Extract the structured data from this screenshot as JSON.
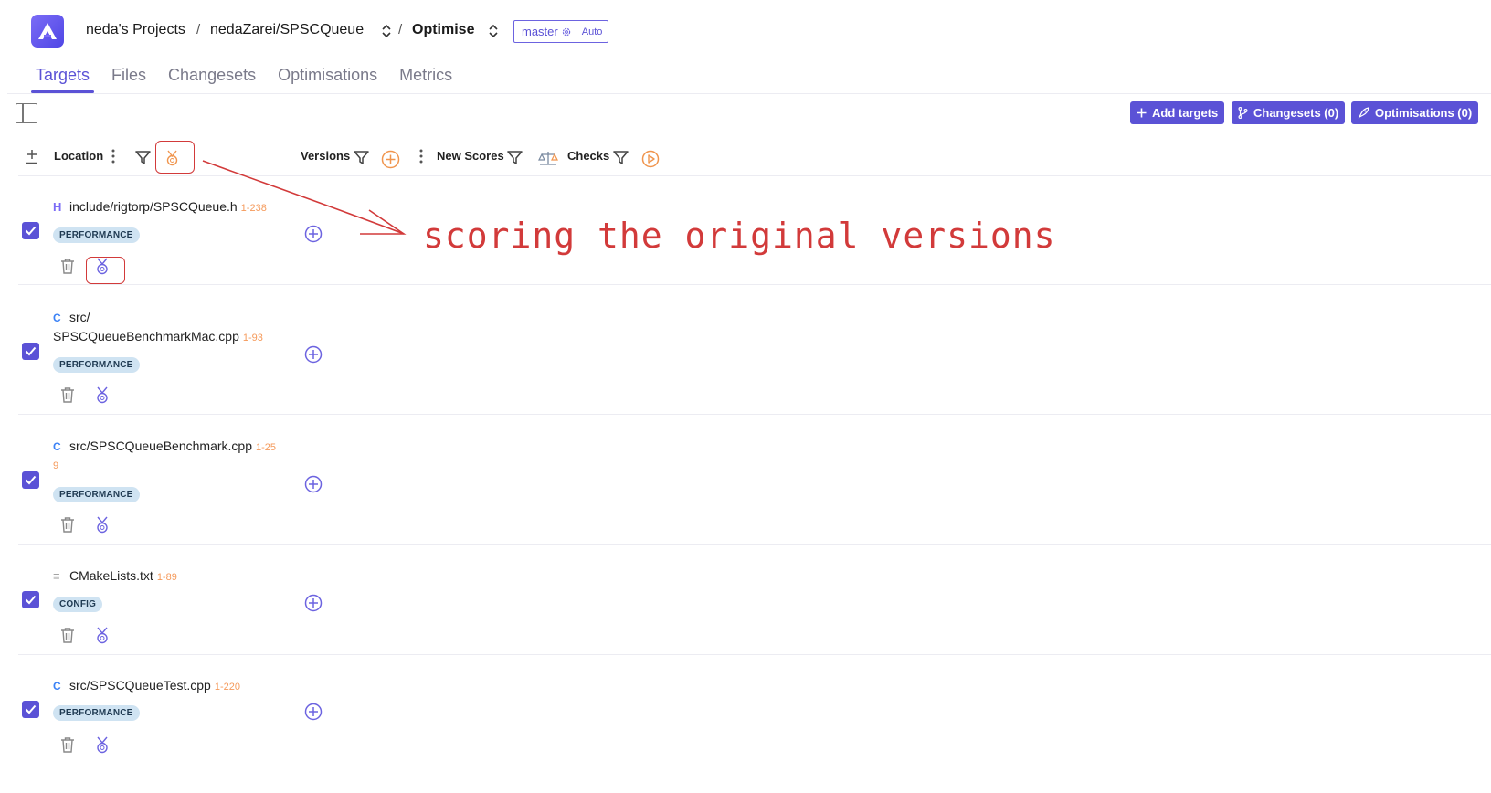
{
  "header": {
    "breadcrumb": {
      "workspace": "neda's Projects",
      "repo": "nedaZarei/SPSCQueue",
      "page": "Optimise",
      "separator": "/"
    },
    "branch": {
      "name": "master",
      "mode": "Auto"
    }
  },
  "tabs": [
    {
      "label": "Targets",
      "active": true
    },
    {
      "label": "Files",
      "active": false
    },
    {
      "label": "Changesets",
      "active": false
    },
    {
      "label": "Optimisations",
      "active": false
    },
    {
      "label": "Metrics",
      "active": false
    }
  ],
  "toolbar": {
    "add_targets": "Add targets",
    "changesets": "Changesets (0)",
    "optimisations": "Optimisations (0)"
  },
  "columns": {
    "location": "Location",
    "versions": "Versions",
    "new_scores": "New Scores",
    "checks": "Checks"
  },
  "rows": [
    {
      "icon": "header-file-icon",
      "type_glyph": "H",
      "path_line1": "include/rigtorp/SPSCQueue.h",
      "path_line2": "",
      "range": "1-238",
      "range_wrap": "",
      "tag": "PERFORMANCE",
      "checked": true
    },
    {
      "icon": "cpp-file-icon",
      "type_glyph": "C",
      "path_line1": "src/",
      "path_line2": "SPSCQueueBenchmarkMac.cpp",
      "range": "1-93",
      "range_wrap": "",
      "tag": "PERFORMANCE",
      "checked": true
    },
    {
      "icon": "cpp-file-icon",
      "type_glyph": "C",
      "path_line1": "src/SPSCQueueBenchmark.cpp",
      "path_line2": "",
      "range": "1-25",
      "range_wrap": "9",
      "tag": "PERFORMANCE",
      "checked": true
    },
    {
      "icon": "text-file-icon",
      "type_glyph": "≡",
      "path_line1": "CMakeLists.txt",
      "path_line2": "",
      "range": "1-89",
      "range_wrap": "",
      "tag": "CONFIG",
      "checked": true
    },
    {
      "icon": "cpp-file-icon",
      "type_glyph": "C",
      "path_line1": "src/SPSCQueueTest.cpp",
      "path_line2": "",
      "range": "1-220",
      "range_wrap": "",
      "tag": "PERFORMANCE",
      "checked": true
    }
  ],
  "annotation": {
    "text": "scoring the original versions",
    "color": "#d23a3a"
  },
  "colors": {
    "accent": "#5b52d6",
    "tag_bg": "#cfe3f2",
    "range": "#f59a5b",
    "annotation": "#d23a3a"
  }
}
